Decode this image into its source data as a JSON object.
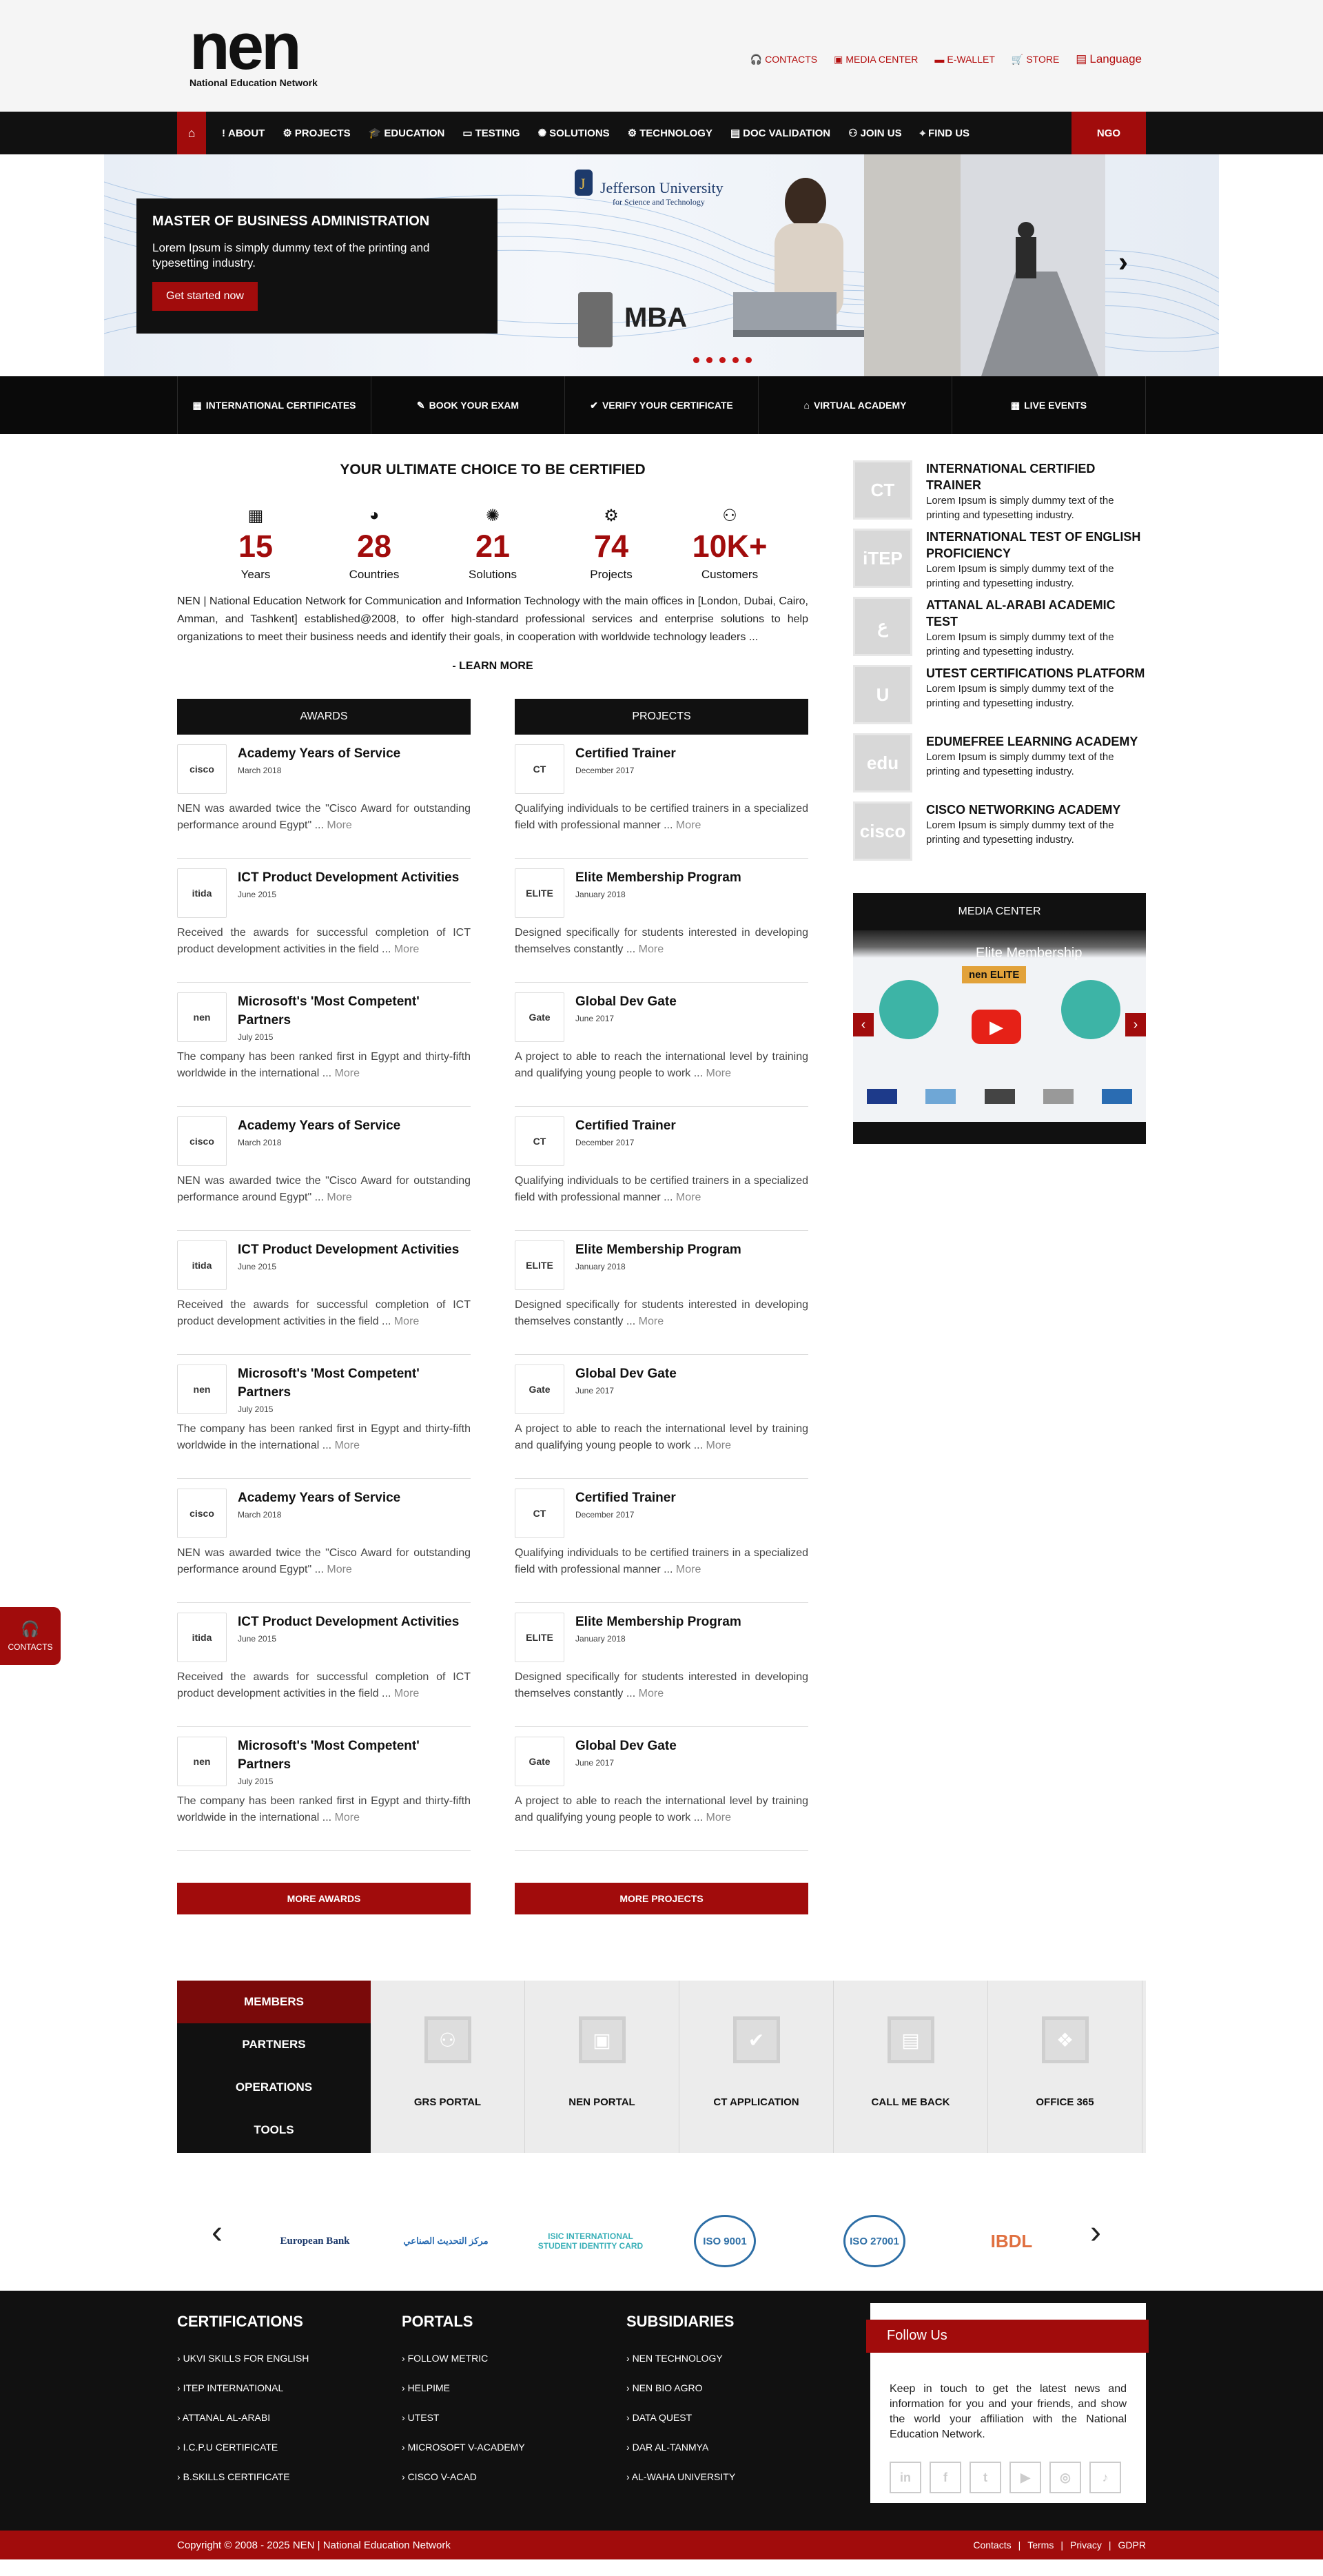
{
  "header": {
    "logo_mark": "nen",
    "logo_sub": "National Education Network",
    "links": [
      "CONTACTS",
      "MEDIA CENTER",
      "E-WALLET",
      "STORE"
    ],
    "language": "Language"
  },
  "nav": {
    "items": [
      "ABOUT",
      "PROJECTS",
      "EDUCATION",
      "TESTING",
      "SOLUTIONS",
      "TECHNOLOGY",
      "DOC VALIDATION",
      "JOIN US",
      "FIND US"
    ],
    "ngo": "NGO"
  },
  "hero": {
    "title": "MASTER OF BUSINESS ADMINISTRATION",
    "text": "Lorem Ipsum is simply dummy text of the printing and typesetting industry.",
    "button": "Get started now",
    "university": "Jefferson University",
    "university_sub": "for Science and Technology",
    "badge": "MBA"
  },
  "quickbar": [
    "INTERNATIONAL CERTIFICATES",
    "BOOK YOUR EXAM",
    "VERIFY YOUR CERTIFICATE",
    "VIRTUAL ACADEMY",
    "LIVE EVENTS"
  ],
  "intro": {
    "title": "YOUR ULTIMATE CHOICE TO BE CERTIFIED",
    "stats": [
      {
        "num": "15",
        "label": "Years",
        "icon": "calendar-icon"
      },
      {
        "num": "28",
        "label": "Countries",
        "icon": "globe-icon"
      },
      {
        "num": "21",
        "label": "Solutions",
        "icon": "bulb-icon"
      },
      {
        "num": "74",
        "label": "Projects",
        "icon": "gears-icon"
      },
      {
        "num": "10K+",
        "label": "Customers",
        "icon": "users-icon"
      }
    ],
    "about": "NEN | National Education Network for Communication and Information Technology with the main offices in [London, Dubai, Cairo, Amman, and Tashkent] established@2008, to offer high-standard professional services and enterprise solutions to help organizations to meet their business needs and identify their goals, in cooperation with worldwide technology leaders ...",
    "learn_more": "- LEARN MORE"
  },
  "awards": {
    "heading": "AWARDS",
    "items": [
      {
        "title": "Academy Years of Service",
        "date": "March 2018",
        "text": "NEN was awarded twice the \"Cisco Award for outstanding performance around Egypt\" ...",
        "thumb": "cisco"
      },
      {
        "title": "ICT Product Development Activities",
        "date": "June 2015",
        "text": "Received the awards for successful completion of ICT product development activities in the field ...",
        "thumb": "itida"
      },
      {
        "title": "Microsoft's 'Most Competent' Partners",
        "date": "July 2015",
        "text": "The company has been ranked first in Egypt and thirty-fifth worldwide in the international ...",
        "thumb": "nen"
      },
      {
        "title": "Academy Years of Service",
        "date": "March 2018",
        "text": "NEN was awarded twice the \"Cisco Award for outstanding performance around Egypt\" ...",
        "thumb": "cisco"
      },
      {
        "title": "ICT Product Development Activities",
        "date": "June 2015",
        "text": "Received the awards for successful completion of ICT product development activities in the field ...",
        "thumb": "itida"
      },
      {
        "title": "Microsoft's 'Most Competent' Partners",
        "date": "July 2015",
        "text": "The company has been ranked first in Egypt and thirty-fifth worldwide in the international ...",
        "thumb": "nen"
      },
      {
        "title": "Academy Years of Service",
        "date": "March 2018",
        "text": "NEN was awarded twice the \"Cisco Award for outstanding performance around Egypt\" ...",
        "thumb": "cisco"
      },
      {
        "title": "ICT Product Development Activities",
        "date": "June 2015",
        "text": "Received the awards for successful completion of ICT product development activities in the field ...",
        "thumb": "itida"
      },
      {
        "title": "Microsoft's 'Most Competent' Partners",
        "date": "July 2015",
        "text": "The company has been ranked first in Egypt and thirty-fifth worldwide in the international ...",
        "thumb": "nen"
      }
    ],
    "more": "MORE AWARDS"
  },
  "projects": {
    "heading": "PROJECTS",
    "items": [
      {
        "title": "Certified Trainer",
        "date": "December 2017",
        "text": "Qualifying individuals to be certified trainers in a specialized field with professional manner ...",
        "thumb": "CT"
      },
      {
        "title": "Elite Membership Program",
        "date": "January 2018",
        "text": "Designed specifically for students interested in developing themselves constantly ...",
        "thumb": "ELITE"
      },
      {
        "title": "Global Dev Gate",
        "date": "June 2017",
        "text": "A project to able to reach the international level by training and qualifying young people to work ...",
        "thumb": "Gate"
      },
      {
        "title": "Certified Trainer",
        "date": "December 2017",
        "text": "Qualifying individuals to be certified trainers in a specialized field with professional manner ...",
        "thumb": "CT"
      },
      {
        "title": "Elite Membership Program",
        "date": "January 2018",
        "text": "Designed specifically for students interested in developing themselves constantly ...",
        "thumb": "ELITE"
      },
      {
        "title": "Global Dev Gate",
        "date": "June 2017",
        "text": "A project to able to reach the international level by training and qualifying young people to work ...",
        "thumb": "Gate"
      },
      {
        "title": "Certified Trainer",
        "date": "December 2017",
        "text": "Qualifying individuals to be certified trainers in a specialized field with professional manner ...",
        "thumb": "CT"
      },
      {
        "title": "Elite Membership Program",
        "date": "January 2018",
        "text": "Designed specifically for students interested in developing themselves constantly ...",
        "thumb": "ELITE"
      },
      {
        "title": "Global Dev Gate",
        "date": "June 2017",
        "text": "A project to able to reach the international level by training and qualifying young people to work ...",
        "thumb": "Gate"
      }
    ],
    "more": "MORE PROJECTS"
  },
  "more_label": "More",
  "certs": [
    {
      "title": "INTERNATIONAL CERTIFIED TRAINER",
      "text": "Lorem Ipsum is simply dummy text of the printing and typesetting industry.",
      "mark": "CT"
    },
    {
      "title": "INTERNATIONAL TEST OF ENGLISH PROFICIENCY",
      "text": "Lorem Ipsum is simply dummy text of the printing and typesetting industry.",
      "mark": "iTEP"
    },
    {
      "title": "ATTANAL AL-ARABI ACADEMIC TEST",
      "text": "Lorem Ipsum is simply dummy text of the printing and typesetting industry.",
      "mark": "ع"
    },
    {
      "title": "UTEST CERTIFICATIONS PLATFORM",
      "text": "Lorem Ipsum is simply dummy text of the printing and typesetting industry.",
      "mark": "U"
    },
    {
      "title": "EDUMEFREE LEARNING ACADEMY",
      "text": "Lorem Ipsum is simply dummy text of the printing and typesetting industry.",
      "mark": "edu"
    },
    {
      "title": "CISCO NETWORKING ACADEMY",
      "text": "Lorem Ipsum is simply dummy text of the printing and typesetting industry.",
      "mark": "cisco"
    }
  ],
  "media": {
    "heading": "MEDIA CENTER",
    "video_title": "Elite Membership",
    "video_badge": "nen ELITE"
  },
  "tabs": {
    "menu": [
      "MEMBERS",
      "PARTNERS",
      "OPERATIONS",
      "TOOLS"
    ],
    "cards": [
      "GRS PORTAL",
      "NEN PORTAL",
      "CT APPLICATION",
      "CALL ME BACK",
      "OFFICE 365"
    ]
  },
  "partners": [
    "European Bank",
    "مركز التحديث الصناعي",
    "ISIC INTERNATIONAL STUDENT IDENTITY CARD",
    "ISO 9001",
    "ISO 27001",
    "IBDL"
  ],
  "footer": {
    "cols": [
      {
        "title": "CERTIFICATIONS",
        "links": [
          "UKVI SKILLS FOR ENGLISH",
          "ITEP INTERNATIONAL",
          "ATTANAL AL-ARABI",
          "I.C.P.U CERTIFICATE",
          "B.SKILLS CERTIFICATE"
        ]
      },
      {
        "title": "PORTALS",
        "links": [
          "FOLLOW METRIC",
          "HELPIME",
          "UTEST",
          "MICROSOFT V-ACADEMY",
          "CISCO V-ACAD"
        ]
      },
      {
        "title": "SUBSIDIARIES",
        "links": [
          "NEN TECHNOLOGY",
          "NEN BIO AGRO",
          "DATA QUEST",
          "DAR AL-TANMYA",
          "AL-WAHA UNIVERSITY"
        ]
      }
    ],
    "follow_title": "Follow Us",
    "follow_text": "Keep in touch to get the latest news and information for you and your friends, and show the world your affiliation with the National Education Network.",
    "social": [
      "in",
      "f",
      "t",
      "▶",
      "◎",
      "♪"
    ]
  },
  "copyright": "Copyright © 2008 - 2025 NEN | National Education Network",
  "bottom_links": [
    "Contacts",
    "Terms",
    "Privacy",
    "GDPR"
  ],
  "float_contact": "CONTACTS",
  "colors": {
    "accent": "#a10c0c",
    "dark": "#111111"
  }
}
